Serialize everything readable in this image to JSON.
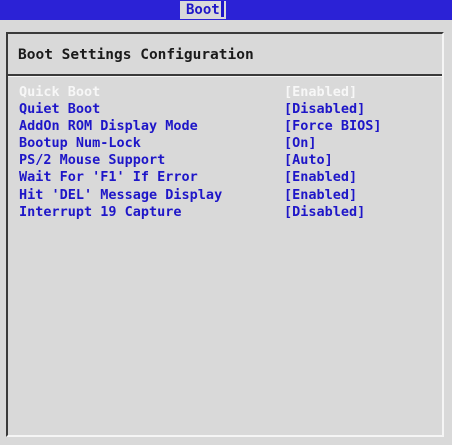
{
  "topbar": {
    "active_tab": "Boot"
  },
  "section": {
    "title": "Boot Settings Configuration"
  },
  "settings": [
    {
      "label": "Quick Boot",
      "value": "[Enabled]",
      "highlighted": true
    },
    {
      "label": "Quiet Boot",
      "value": "[Disabled]"
    },
    {
      "label": "AddOn ROM Display Mode",
      "value": "[Force BIOS]"
    },
    {
      "label": "Bootup Num-Lock",
      "value": "[On]"
    },
    {
      "label": "PS/2 Mouse Support",
      "value": "[Auto]"
    },
    {
      "label": "Wait For 'F1' If Error",
      "value": "[Enabled]"
    },
    {
      "label": "Hit 'DEL' Message Display",
      "value": "[Enabled]"
    },
    {
      "label": "Interrupt 19 Capture",
      "value": "[Disabled]"
    }
  ],
  "colors": {
    "header_blue": "#2b22d6",
    "text_blue": "#1e16c8",
    "background_gray": "#d9d9d9",
    "highlight_text": "#f7f7f7"
  }
}
